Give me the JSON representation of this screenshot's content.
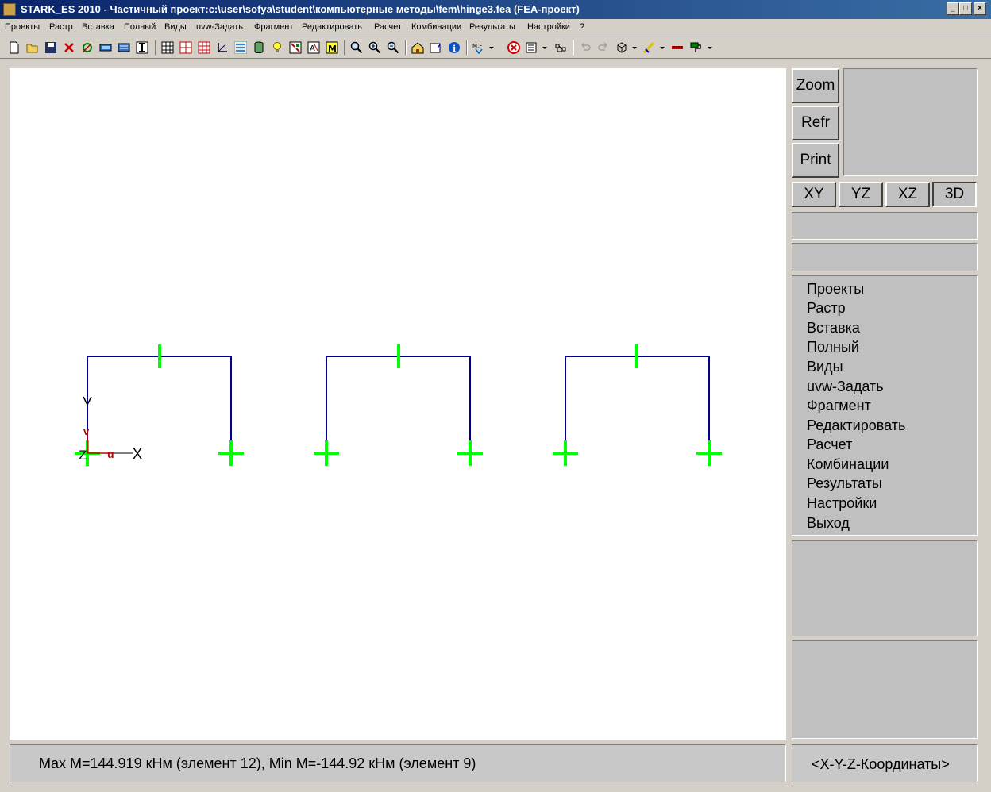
{
  "window": {
    "title": "STARK_ES 2010 - Частичный проект:c:\\user\\sofya\\student\\компьютерные методы\\fem\\hinge3.fea  (FEA-проект)",
    "minimize": "_",
    "maximize": "□",
    "close": "×"
  },
  "menu": [
    "Проекты",
    "Растр",
    "Вставка",
    "Полный",
    "Виды",
    "uvw-Задать",
    "Фрагмент",
    "Редактировать",
    "Расчет",
    "Комбинации",
    "Результаты",
    "Настройки",
    "?"
  ],
  "toolbar_icons": [
    "new-icon",
    "open-icon",
    "save-icon",
    "delete-icon",
    "node-icon",
    "element-icon",
    "section-icon",
    "grid-icon",
    "grid2-icon",
    "grid3-icon",
    "axes-icon",
    "layers-icon",
    "database-icon",
    "bulb-icon",
    "view-icon",
    "text-icon",
    "m-icon",
    "zoom-icon",
    "zoom-in-icon",
    "zoom-out-icon",
    "home-icon",
    "help-icon",
    "info-icon",
    "mf-icon",
    "stop-icon",
    "list-icon",
    "link-icon",
    "undo-icon",
    "redo-icon",
    "cube-icon",
    "paint-icon",
    "ruler-icon",
    "brush-icon"
  ],
  "side": {
    "zoom": "Zoom",
    "refr": "Refr",
    "print": "Print",
    "views": [
      "XY",
      "YZ",
      "XZ",
      "3D"
    ],
    "menu": [
      "Проекты",
      "Растр",
      "Вставка",
      "Полный",
      "Виды",
      "uvw-Задать",
      "Фрагмент",
      "Редактировать",
      "Расчет",
      "Комбинации",
      "Результаты",
      "Настройки",
      "Выход"
    ]
  },
  "canvas": {
    "axis_x": "X",
    "axis_y": "Y",
    "axis_z": "Z",
    "axis_u": "u",
    "axis_v": "v",
    "structure_color": "#00008b",
    "hinge_color": "#00ff00"
  },
  "status": {
    "moments": "Max M=144.919 кНм (элемент 12), Min M=-144.92 кНм (элемент 9)",
    "coords": "<X-Y-Z-Координаты>"
  }
}
